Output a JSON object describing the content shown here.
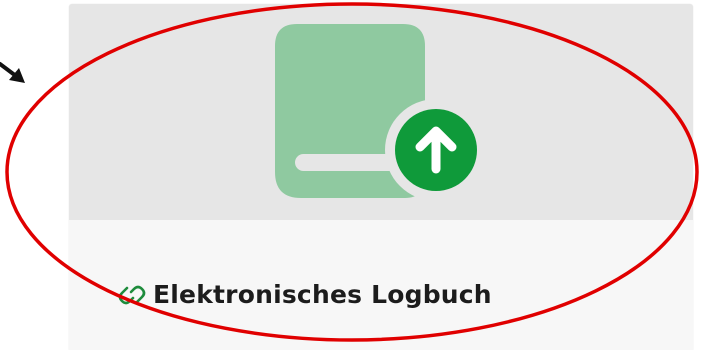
{
  "tile": {
    "title": "Elektronisches Logbuch",
    "image_icon": "book-upload-icon",
    "link_icon": "link-icon"
  },
  "annotation": {
    "highlight_shape": "red-ellipse",
    "pointer": "black-arrow"
  },
  "colors": {
    "book_fill": "#8fc9a0",
    "badge_green": "#0f9a3a",
    "badge_arrow": "#ffffff",
    "tile_image_bg": "#e6e6e6",
    "tile_footer_bg": "#f7f7f7",
    "link_icon_green": "#1e8c3c",
    "title_text": "#1c1c1c",
    "annotation_red": "#e00000"
  }
}
